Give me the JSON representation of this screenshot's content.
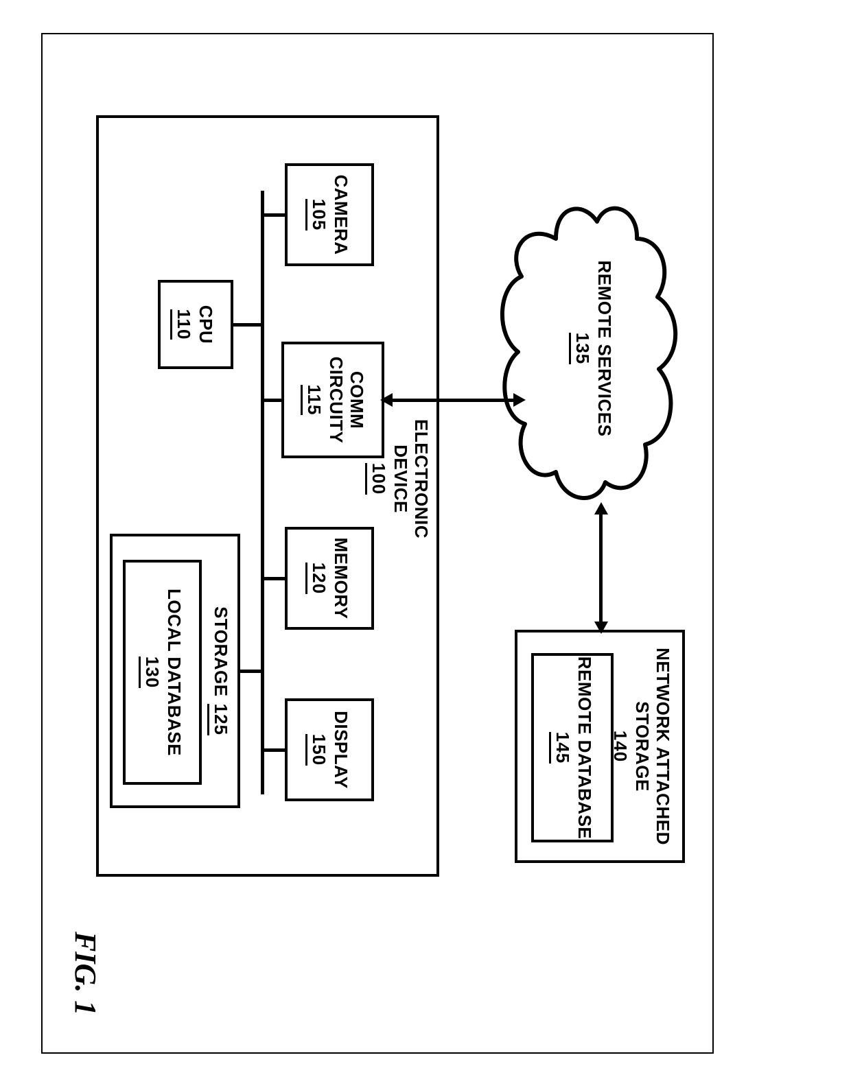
{
  "figure": {
    "caption": "FIG. 1"
  },
  "remote_services": {
    "label": "REMOTE SERVICES",
    "ref": "135"
  },
  "nas": {
    "label": "NETWORK ATTACHED STORAGE",
    "ref": "140",
    "db": {
      "label": "REMOTE DATABASE",
      "ref": "145"
    }
  },
  "device": {
    "label": "ELECTRONIC DEVICE",
    "ref": "100",
    "camera": {
      "label": "CAMERA",
      "ref": "105"
    },
    "cpu": {
      "label": "CPU",
      "ref": "110"
    },
    "comm": {
      "label1": "COMM",
      "label2": "CIRCUITY",
      "ref": "115"
    },
    "memory": {
      "label": "MEMORY",
      "ref": "120"
    },
    "display": {
      "label": "DISPLAY",
      "ref": "150"
    },
    "storage": {
      "label": "STORAGE",
      "ref": "125",
      "db": {
        "label": "LOCAL DATABASE",
        "ref": "130"
      }
    }
  }
}
